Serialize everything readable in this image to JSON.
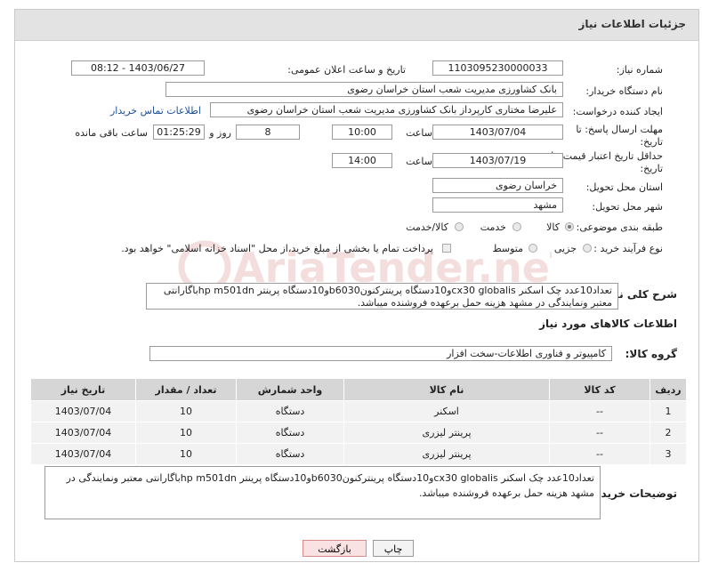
{
  "page": {
    "title": "جزئیات اطلاعات نیاز"
  },
  "form": {
    "need_number_label": "شماره نیاز:",
    "need_number": "1103095230000033",
    "announce_label": "تاریخ و ساعت اعلان عمومی:",
    "announce_value": "1403/06/27 - 08:12",
    "buyer_label": "نام دستگاه خریدار:",
    "buyer_value": "بانک کشاورزی مدیریت شعب استان خراسان رضوی",
    "creator_label": "ایجاد کننده درخواست:",
    "creator_value": "علیرضا مختاری کارپرداز بانک کشاورزی مدیریت شعب استان خراسان رضوی",
    "contact_link": "اطلاعات تماس خریدار",
    "deadline_label_1": "مهلت ارسال پاسخ: تا",
    "deadline_label_2": "تاریخ:",
    "deadline_date": "1403/07/04",
    "time_label": "ساعت",
    "deadline_time": "10:00",
    "days_value": "8",
    "days_label": "روز و",
    "remaining_time": "01:25:29",
    "remaining_label": "ساعت باقی مانده",
    "validity_label_1": "حداقل تاریخ اعتبار قیمت: تا",
    "validity_label_2": "تاریخ:",
    "validity_date": "1403/07/19",
    "validity_time": "14:00",
    "province_label": "استان محل تحویل:",
    "province_value": "خراسان رضوی",
    "city_label": "شهر محل تحویل:",
    "city_value": "مشهد",
    "category_label": "طبقه بندی موضوعی:",
    "category_options": [
      "کالا",
      "خدمت",
      "کالا/خدمت"
    ],
    "process_label": "نوع فرآیند خرید :",
    "process_options": [
      "جزیی",
      "متوسط"
    ],
    "payment_note": "پرداخت تمام یا بخشی از مبلغ خرید،از محل \"اسناد خزانه اسلامی\" خواهد بود."
  },
  "description": {
    "label": "شرح کلی نیاز:",
    "line1": "تعداد10عدد چک اسکنر cx30 globalisو10دستگاه پرینترکنونb6030و10دستگاه پرینتر hp m501dnباگارانتی",
    "line2": "معتبر ونمایندگی در مشهد هزینه حمل برعهده فروشنده میباشد."
  },
  "goods": {
    "section_title": "اطلاعات کالاهای مورد نیاز",
    "group_label": "گروه کالا:",
    "group_value": "کامپیوتر و فناوری اطلاعات-سخت افزار",
    "headers": [
      "ردیف",
      "کد کالا",
      "نام کالا",
      "واحد شمارش",
      "تعداد / مقدار",
      "تاریخ نیاز"
    ],
    "rows": [
      {
        "idx": "1",
        "code": "--",
        "name": "اسکنر",
        "unit": "دستگاه",
        "qty": "10",
        "date": "1403/07/04"
      },
      {
        "idx": "2",
        "code": "--",
        "name": "پرینتر لیزری",
        "unit": "دستگاه",
        "qty": "10",
        "date": "1403/07/04"
      },
      {
        "idx": "3",
        "code": "--",
        "name": "پرینتر لیزری",
        "unit": "دستگاه",
        "qty": "10",
        "date": "1403/07/04"
      }
    ]
  },
  "buyer_notes": {
    "label": "توضیحات خریدار:",
    "line1": "تعداد10عدد چک اسکنر cx30 globalisو10دستگاه پرینترکنونb6030و10دستگاه پرینتر hp m501dnباگارانتی معتبر ونمایندگی در",
    "line2": "مشهد هزینه حمل برعهده فروشنده میباشد."
  },
  "buttons": {
    "print": "چاپ",
    "back": "بازگشت"
  },
  "watermark": "AriaTender.neT"
}
